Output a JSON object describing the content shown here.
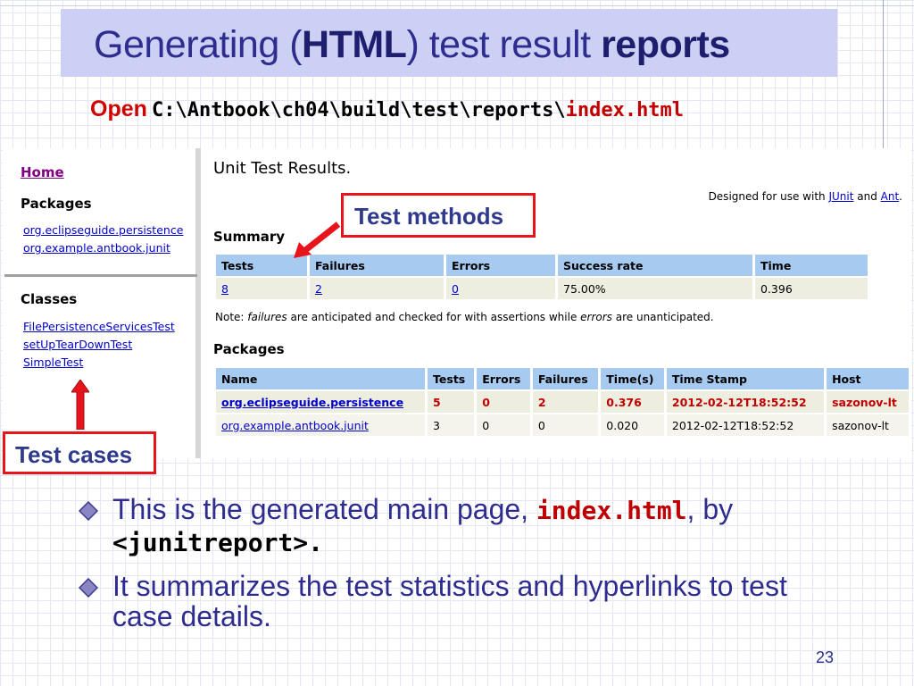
{
  "slide": {
    "title_part1": "Generating (",
    "title_bold1": "HTML",
    "title_part2": ") test result ",
    "title_bold2": "reports",
    "open_label": "Open",
    "path_prefix": "C:\\Antbook\\ch04\\build\\test\\reports\\",
    "path_file": "index.html",
    "page_number": "23"
  },
  "callouts": {
    "test_methods": "Test methods",
    "test_cases": "Test cases"
  },
  "sidebar": {
    "home": "Home",
    "packages_heading": "Packages",
    "packages": [
      "org.eclipseguide.persistence",
      "org.example.antbook.junit"
    ],
    "classes_heading": "Classes",
    "classes": [
      "FilePersistenceServicesTest",
      "setUpTearDownTest",
      "SimpleTest"
    ]
  },
  "report": {
    "title": "Unit Test Results.",
    "designed_prefix": "Designed for use with ",
    "junit_link": "JUnit",
    "designed_and": " and ",
    "ant_link": "Ant",
    "designed_suffix": ".",
    "summary_heading": "Summary",
    "summary_headers": [
      "Tests",
      "Failures",
      "Errors",
      "Success rate",
      "Time"
    ],
    "summary_values": [
      "8",
      "2",
      "0",
      "75.00%",
      "0.396"
    ],
    "note_prefix": "Note: ",
    "note_failures": "failures",
    "note_middle": " are anticipated and checked for with assertions while ",
    "note_errors": "errors",
    "note_suffix": " are unanticipated.",
    "packages_heading": "Packages",
    "packages_headers": [
      "Name",
      "Tests",
      "Errors",
      "Failures",
      "Time(s)",
      "Time Stamp",
      "Host"
    ],
    "packages_rows": [
      [
        "org.eclipseguide.persistence",
        "5",
        "0",
        "2",
        "0.376",
        "2012-02-12T18:52:52",
        "sazonov-lt"
      ],
      [
        "org.example.antbook.junit",
        "3",
        "0",
        "0",
        "0.020",
        "2012-02-12T18:52:52",
        "sazonov-lt"
      ]
    ]
  },
  "bullets": {
    "b1_text1": "This is the generated main page, ",
    "b1_code": "index.html",
    "b1_text2": ", by",
    "b1_code2": "<junitreport>.",
    "b2_text": "It summarizes the test statistics and hyperlinks to test case details."
  },
  "colors": {
    "title_band": "#ccd0f4",
    "title_text": "#2e2c8e",
    "callout_border": "#e8141c",
    "table_header": "#a6caf0",
    "table_cell": "#eeeee0",
    "link": "#0000cc"
  }
}
